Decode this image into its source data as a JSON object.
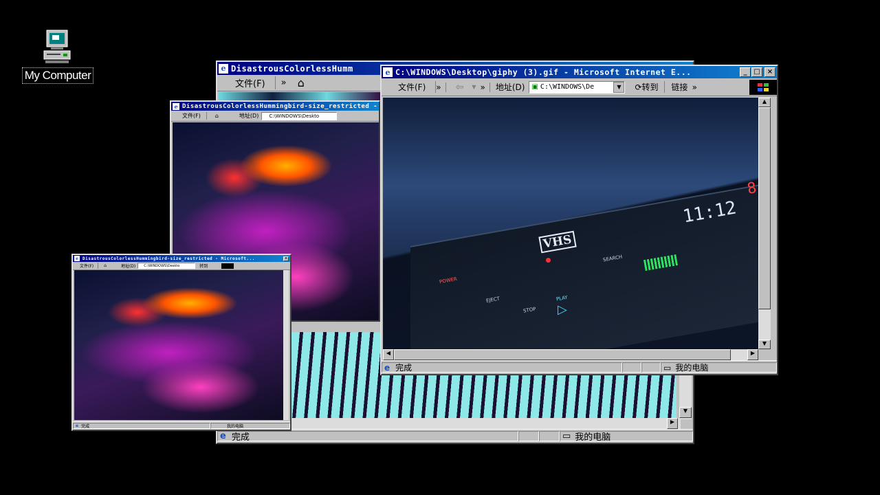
{
  "desktop": {
    "icon_label": "My Computer"
  },
  "window_back": {
    "title": "DisastrousColorlessHumm",
    "file_menu": "文件(F)",
    "chevron": "»",
    "status_left": "完成",
    "status_right": "我的电脑"
  },
  "window_mid": {
    "title": "DisastrousColorlessHummingbird-size_restricted - M",
    "file_menu": "文件(F)",
    "address_label": "地址(D)",
    "address_value": "C:\\WINDOWS\\Deskto"
  },
  "window_small": {
    "title": "DisastrousColorlessHummingbird-size_restricted - Microsoft...",
    "file_menu": "文件(F)",
    "address_label": "地址(D)",
    "address_value": "C:\\WINDOWS\\Deskto",
    "goto": "转到",
    "status_left": "完成",
    "status_right": "我的电脑"
  },
  "window_front": {
    "title": "C:\\WINDOWS\\Desktop\\giphy (3).gif - Microsoft Internet E...",
    "file_menu": "文件(F)",
    "chevron": "»",
    "address_label": "地址(D)",
    "address_value": "C:\\WINDOWS\\De",
    "goto": "转到",
    "links": "链接",
    "status_left": "完成",
    "status_right": "我的电脑",
    "vcr_brand": "VHS",
    "vcr_time": "11:12",
    "vcr_channel": "8",
    "vcr_power": "POWER",
    "vcr_play": "PLAY",
    "vcr_stop": "STOP",
    "vcr_eject": "EJECT",
    "vcr_search": "SEARCH"
  },
  "colors": {
    "title_start": "#000080",
    "title_end": "#1084d0",
    "chrome": "#c0c0c0"
  }
}
